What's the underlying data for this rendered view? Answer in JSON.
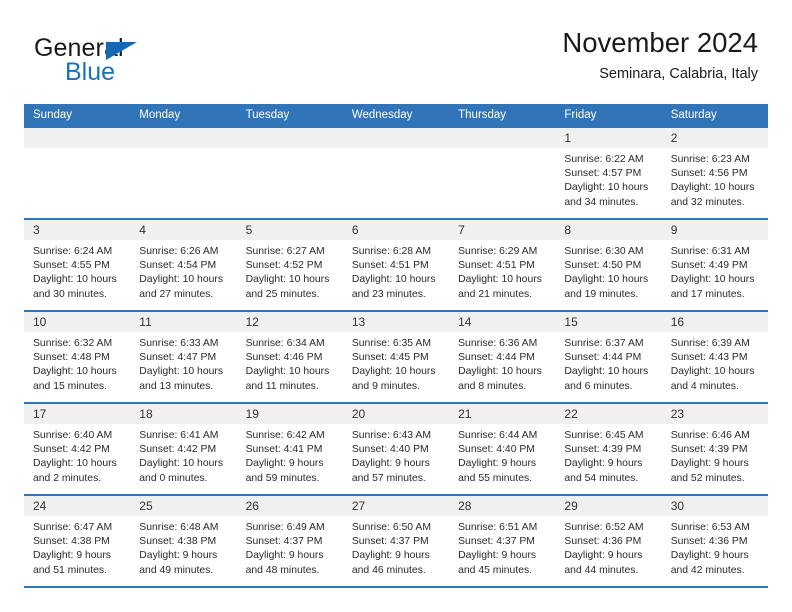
{
  "brand": {
    "name_part1": "General",
    "name_part2": "Blue",
    "triangle_icon": "triangle-icon",
    "primary_color": "#1773bc"
  },
  "header": {
    "title": "November 2024",
    "subtitle": "Seminara, Calabria, Italy"
  },
  "calendar": {
    "accent_color": "#3175b8",
    "daynum_band_color": "#f0f0f0",
    "weekdays": [
      "Sunday",
      "Monday",
      "Tuesday",
      "Wednesday",
      "Thursday",
      "Friday",
      "Saturday"
    ],
    "weeks": [
      [
        {
          "day": "",
          "lines": []
        },
        {
          "day": "",
          "lines": []
        },
        {
          "day": "",
          "lines": []
        },
        {
          "day": "",
          "lines": []
        },
        {
          "day": "",
          "lines": []
        },
        {
          "day": "1",
          "lines": [
            "Sunrise: 6:22 AM",
            "Sunset: 4:57 PM",
            "Daylight: 10 hours",
            "and 34 minutes."
          ]
        },
        {
          "day": "2",
          "lines": [
            "Sunrise: 6:23 AM",
            "Sunset: 4:56 PM",
            "Daylight: 10 hours",
            "and 32 minutes."
          ]
        }
      ],
      [
        {
          "day": "3",
          "lines": [
            "Sunrise: 6:24 AM",
            "Sunset: 4:55 PM",
            "Daylight: 10 hours",
            "and 30 minutes."
          ]
        },
        {
          "day": "4",
          "lines": [
            "Sunrise: 6:26 AM",
            "Sunset: 4:54 PM",
            "Daylight: 10 hours",
            "and 27 minutes."
          ]
        },
        {
          "day": "5",
          "lines": [
            "Sunrise: 6:27 AM",
            "Sunset: 4:52 PM",
            "Daylight: 10 hours",
            "and 25 minutes."
          ]
        },
        {
          "day": "6",
          "lines": [
            "Sunrise: 6:28 AM",
            "Sunset: 4:51 PM",
            "Daylight: 10 hours",
            "and 23 minutes."
          ]
        },
        {
          "day": "7",
          "lines": [
            "Sunrise: 6:29 AM",
            "Sunset: 4:51 PM",
            "Daylight: 10 hours",
            "and 21 minutes."
          ]
        },
        {
          "day": "8",
          "lines": [
            "Sunrise: 6:30 AM",
            "Sunset: 4:50 PM",
            "Daylight: 10 hours",
            "and 19 minutes."
          ]
        },
        {
          "day": "9",
          "lines": [
            "Sunrise: 6:31 AM",
            "Sunset: 4:49 PM",
            "Daylight: 10 hours",
            "and 17 minutes."
          ]
        }
      ],
      [
        {
          "day": "10",
          "lines": [
            "Sunrise: 6:32 AM",
            "Sunset: 4:48 PM",
            "Daylight: 10 hours",
            "and 15 minutes."
          ]
        },
        {
          "day": "11",
          "lines": [
            "Sunrise: 6:33 AM",
            "Sunset: 4:47 PM",
            "Daylight: 10 hours",
            "and 13 minutes."
          ]
        },
        {
          "day": "12",
          "lines": [
            "Sunrise: 6:34 AM",
            "Sunset: 4:46 PM",
            "Daylight: 10 hours",
            "and 11 minutes."
          ]
        },
        {
          "day": "13",
          "lines": [
            "Sunrise: 6:35 AM",
            "Sunset: 4:45 PM",
            "Daylight: 10 hours",
            "and 9 minutes."
          ]
        },
        {
          "day": "14",
          "lines": [
            "Sunrise: 6:36 AM",
            "Sunset: 4:44 PM",
            "Daylight: 10 hours",
            "and 8 minutes."
          ]
        },
        {
          "day": "15",
          "lines": [
            "Sunrise: 6:37 AM",
            "Sunset: 4:44 PM",
            "Daylight: 10 hours",
            "and 6 minutes."
          ]
        },
        {
          "day": "16",
          "lines": [
            "Sunrise: 6:39 AM",
            "Sunset: 4:43 PM",
            "Daylight: 10 hours",
            "and 4 minutes."
          ]
        }
      ],
      [
        {
          "day": "17",
          "lines": [
            "Sunrise: 6:40 AM",
            "Sunset: 4:42 PM",
            "Daylight: 10 hours",
            "and 2 minutes."
          ]
        },
        {
          "day": "18",
          "lines": [
            "Sunrise: 6:41 AM",
            "Sunset: 4:42 PM",
            "Daylight: 10 hours",
            "and 0 minutes."
          ]
        },
        {
          "day": "19",
          "lines": [
            "Sunrise: 6:42 AM",
            "Sunset: 4:41 PM",
            "Daylight: 9 hours",
            "and 59 minutes."
          ]
        },
        {
          "day": "20",
          "lines": [
            "Sunrise: 6:43 AM",
            "Sunset: 4:40 PM",
            "Daylight: 9 hours",
            "and 57 minutes."
          ]
        },
        {
          "day": "21",
          "lines": [
            "Sunrise: 6:44 AM",
            "Sunset: 4:40 PM",
            "Daylight: 9 hours",
            "and 55 minutes."
          ]
        },
        {
          "day": "22",
          "lines": [
            "Sunrise: 6:45 AM",
            "Sunset: 4:39 PM",
            "Daylight: 9 hours",
            "and 54 minutes."
          ]
        },
        {
          "day": "23",
          "lines": [
            "Sunrise: 6:46 AM",
            "Sunset: 4:39 PM",
            "Daylight: 9 hours",
            "and 52 minutes."
          ]
        }
      ],
      [
        {
          "day": "24",
          "lines": [
            "Sunrise: 6:47 AM",
            "Sunset: 4:38 PM",
            "Daylight: 9 hours",
            "and 51 minutes."
          ]
        },
        {
          "day": "25",
          "lines": [
            "Sunrise: 6:48 AM",
            "Sunset: 4:38 PM",
            "Daylight: 9 hours",
            "and 49 minutes."
          ]
        },
        {
          "day": "26",
          "lines": [
            "Sunrise: 6:49 AM",
            "Sunset: 4:37 PM",
            "Daylight: 9 hours",
            "and 48 minutes."
          ]
        },
        {
          "day": "27",
          "lines": [
            "Sunrise: 6:50 AM",
            "Sunset: 4:37 PM",
            "Daylight: 9 hours",
            "and 46 minutes."
          ]
        },
        {
          "day": "28",
          "lines": [
            "Sunrise: 6:51 AM",
            "Sunset: 4:37 PM",
            "Daylight: 9 hours",
            "and 45 minutes."
          ]
        },
        {
          "day": "29",
          "lines": [
            "Sunrise: 6:52 AM",
            "Sunset: 4:36 PM",
            "Daylight: 9 hours",
            "and 44 minutes."
          ]
        },
        {
          "day": "30",
          "lines": [
            "Sunrise: 6:53 AM",
            "Sunset: 4:36 PM",
            "Daylight: 9 hours",
            "and 42 minutes."
          ]
        }
      ]
    ]
  }
}
